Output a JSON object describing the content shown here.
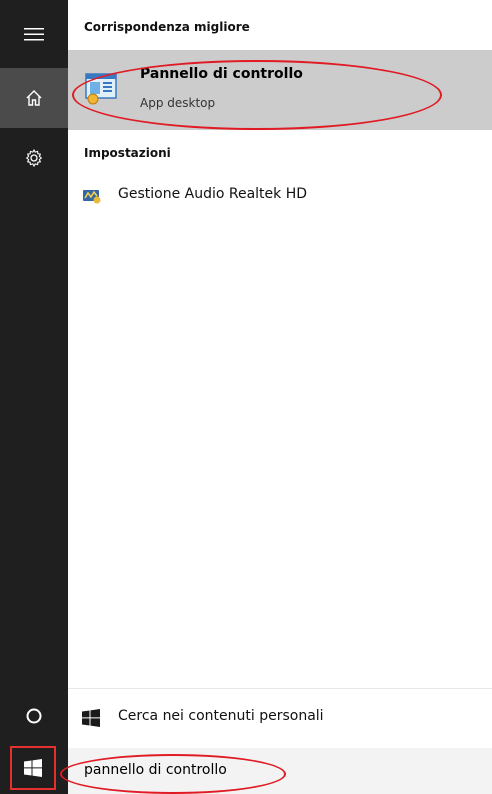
{
  "sidebar": {
    "items": [
      {
        "name": "hamburger-icon"
      },
      {
        "name": "home-icon"
      },
      {
        "name": "gear-icon"
      },
      {
        "name": "cortana-icon"
      },
      {
        "name": "windows-start-icon"
      }
    ]
  },
  "results": {
    "best_match_header": "Corrispondenza migliore",
    "best_match": {
      "title": "Pannello di controllo",
      "subtitle": "App desktop",
      "icon": "control-panel-icon"
    },
    "settings_header": "Impostazioni",
    "settings_items": [
      {
        "label": "Gestione Audio Realtek HD",
        "icon": "realtek-audio-icon"
      }
    ],
    "search_personal": {
      "label": "Cerca nei contenuti personali",
      "icon": "windows-logo-icon"
    }
  },
  "search": {
    "value": "pannello di controllo"
  },
  "colors": {
    "rail_bg": "#1f1f1f",
    "rail_selected": "#4b4b4b",
    "selection_bg": "#cccccc",
    "annotation": "#e01b24"
  }
}
